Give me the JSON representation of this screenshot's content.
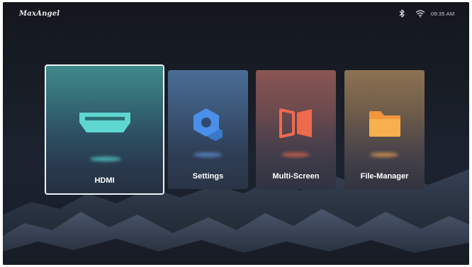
{
  "status_bar": {
    "brand": "MaxAngel",
    "time": "09:35 AM",
    "icons": [
      "bluetooth-icon",
      "wifi-icon"
    ]
  },
  "apps": [
    {
      "label": "HDMI",
      "icon": "hdmi-port-icon",
      "focused": true,
      "accent": "#5fd6d0"
    },
    {
      "label": "Settings",
      "icon": "settings-hexagon-icon",
      "focused": false,
      "accent": "#4a90e8"
    },
    {
      "label": "Multi-Screen",
      "icon": "multi-screen-icon",
      "focused": false,
      "accent": "#ee6a4c"
    },
    {
      "label": "File-Manager",
      "icon": "folder-icon",
      "focused": false,
      "accent": "#f6a44a"
    }
  ]
}
